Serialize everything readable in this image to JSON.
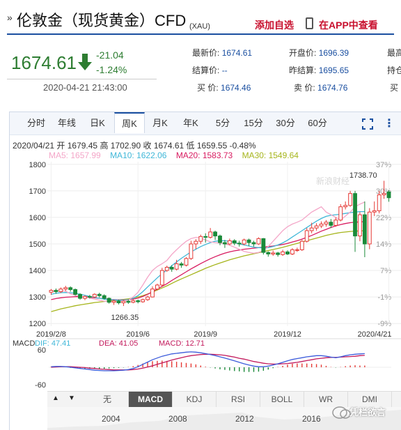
{
  "header": {
    "title_mark": "»",
    "title": "伦敦金（现货黄金）CFD",
    "title_sub": "(XAU)",
    "add_watch": "添加自选",
    "app_view": "在APP中查看"
  },
  "price": {
    "last": "1674.61",
    "change": "-21.04",
    "change_pct": "-1.24%",
    "datetime": "2020-04-21 21:43:00",
    "down_color": "#2e7d32"
  },
  "quotes": [
    {
      "label": "最新价:",
      "value": "1674.61"
    },
    {
      "label": "开盘价:",
      "value": "1696.39"
    },
    {
      "label": "最高",
      "value": ""
    },
    {
      "label": "结算价:",
      "value": "--"
    },
    {
      "label": "昨结算:",
      "value": "1695.65"
    },
    {
      "label": "持仓",
      "value": ""
    },
    {
      "label": "买 价:",
      "value": "1674.46"
    },
    {
      "label": "卖 价:",
      "value": "1674.76"
    },
    {
      "label": "买",
      "value": ""
    }
  ],
  "tabs": [
    "分时",
    "年线",
    "日K",
    "周K",
    "月K",
    "年K",
    "5分",
    "15分",
    "30分",
    "60分"
  ],
  "active_tab": "周K",
  "ohlc": "2020/04/21 开 1679.45 高 1702.90 收 1674.61 低 1659.55 -0.48%",
  "ma": {
    "ma5": "MA5: 1657.99",
    "ma10": "MA10: 1622.06",
    "ma20": "MA20: 1583.73",
    "ma30": "MA30: 1549.64",
    "colors": {
      "ma5": "#f4a6c8",
      "ma10": "#3fb7d8",
      "ma20": "#d81b60",
      "ma30": "#a6b51c"
    }
  },
  "chart_data": {
    "type": "candlestick",
    "y_ticks": [
      "1800",
      "1700",
      "1600",
      "1500",
      "1400",
      "1300",
      "1200"
    ],
    "pct_ticks": [
      "37%",
      "30%",
      "22%",
      "14%",
      "7%",
      "-1%",
      "-9%"
    ],
    "x_ticks": [
      "2019/2/8",
      "2019/6",
      "2019/9",
      "2019/12",
      "2020/4/21"
    ],
    "high_label": "1738.70",
    "low_label": "1266.35",
    "ylim": [
      1190,
      1810
    ],
    "candles": [
      [
        1318,
        1325,
        1308,
        1330
      ],
      [
        1325,
        1320,
        1312,
        1332
      ],
      [
        1320,
        1330,
        1315,
        1336
      ],
      [
        1330,
        1335,
        1322,
        1342
      ],
      [
        1335,
        1328,
        1320,
        1340
      ],
      [
        1328,
        1310,
        1305,
        1332
      ],
      [
        1310,
        1295,
        1290,
        1314
      ],
      [
        1295,
        1302,
        1288,
        1306
      ],
      [
        1302,
        1300,
        1294,
        1308
      ],
      [
        1300,
        1310,
        1296,
        1314
      ],
      [
        1310,
        1305,
        1298,
        1316
      ],
      [
        1305,
        1295,
        1290,
        1310
      ],
      [
        1295,
        1280,
        1275,
        1298
      ],
      [
        1280,
        1285,
        1270,
        1290
      ],
      [
        1285,
        1278,
        1272,
        1290
      ],
      [
        1278,
        1284,
        1266,
        1288
      ],
      [
        1284,
        1280,
        1274,
        1290
      ],
      [
        1280,
        1286,
        1276,
        1292
      ],
      [
        1286,
        1282,
        1276,
        1290
      ],
      [
        1282,
        1290,
        1278,
        1294
      ],
      [
        1290,
        1300,
        1285,
        1305
      ],
      [
        1300,
        1330,
        1298,
        1340
      ],
      [
        1330,
        1345,
        1325,
        1350
      ],
      [
        1345,
        1400,
        1340,
        1410
      ],
      [
        1400,
        1412,
        1395,
        1418
      ],
      [
        1412,
        1405,
        1395,
        1420
      ],
      [
        1405,
        1425,
        1400,
        1440
      ],
      [
        1425,
        1420,
        1410,
        1432
      ],
      [
        1420,
        1445,
        1415,
        1450
      ],
      [
        1445,
        1500,
        1440,
        1512
      ],
      [
        1500,
        1510,
        1480,
        1518
      ],
      [
        1510,
        1528,
        1500,
        1535
      ],
      [
        1528,
        1525,
        1505,
        1540
      ],
      [
        1525,
        1545,
        1520,
        1560
      ],
      [
        1545,
        1530,
        1515,
        1550
      ],
      [
        1530,
        1505,
        1495,
        1535
      ],
      [
        1505,
        1500,
        1485,
        1515
      ],
      [
        1500,
        1512,
        1495,
        1520
      ],
      [
        1512,
        1503,
        1495,
        1518
      ],
      [
        1503,
        1500,
        1490,
        1512
      ],
      [
        1500,
        1515,
        1495,
        1520
      ],
      [
        1515,
        1505,
        1492,
        1520
      ],
      [
        1505,
        1500,
        1490,
        1512
      ],
      [
        1500,
        1520,
        1496,
        1525
      ],
      [
        1520,
        1468,
        1460,
        1522
      ],
      [
        1468,
        1462,
        1452,
        1472
      ],
      [
        1462,
        1466,
        1455,
        1475
      ],
      [
        1466,
        1460,
        1452,
        1470
      ],
      [
        1460,
        1470,
        1455,
        1478
      ],
      [
        1470,
        1462,
        1458,
        1476
      ],
      [
        1462,
        1478,
        1458,
        1484
      ],
      [
        1478,
        1478,
        1470,
        1486
      ],
      [
        1478,
        1510,
        1474,
        1515
      ],
      [
        1510,
        1550,
        1505,
        1560
      ],
      [
        1550,
        1560,
        1540,
        1580
      ],
      [
        1560,
        1568,
        1550,
        1578
      ],
      [
        1568,
        1575,
        1560,
        1585
      ],
      [
        1575,
        1582,
        1565,
        1590
      ],
      [
        1582,
        1570,
        1560,
        1594
      ],
      [
        1570,
        1590,
        1565,
        1600
      ],
      [
        1590,
        1640,
        1585,
        1650
      ],
      [
        1640,
        1645,
        1630,
        1660
      ],
      [
        1645,
        1690,
        1640,
        1700
      ],
      [
        1690,
        1530,
        1470,
        1700
      ],
      [
        1530,
        1610,
        1510,
        1620
      ],
      [
        1610,
        1500,
        1450,
        1660
      ],
      [
        1500,
        1620,
        1480,
        1635
      ],
      [
        1620,
        1625,
        1605,
        1660
      ],
      [
        1625,
        1685,
        1615,
        1700
      ],
      [
        1685,
        1690,
        1670,
        1738
      ],
      [
        1696,
        1674,
        1659,
        1703
      ]
    ],
    "ma_series": {
      "ma5": [
        1318,
        1325,
        1324,
        1322,
        1312,
        1306,
        1302,
        1300,
        1296,
        1292,
        1288,
        1284,
        1283,
        1283,
        1284,
        1286,
        1288,
        1300,
        1318,
        1345,
        1375,
        1400,
        1415,
        1425,
        1438,
        1460,
        1478,
        1495,
        1510,
        1520,
        1525,
        1522,
        1515,
        1508,
        1505,
        1503,
        1500,
        1495,
        1488,
        1480,
        1472,
        1468,
        1465,
        1468,
        1475,
        1490,
        1510,
        1530,
        1550,
        1565,
        1575,
        1582,
        1590,
        1605,
        1620,
        1630,
        1640,
        1620,
        1610,
        1600,
        1590,
        1605,
        1620,
        1640,
        1650,
        1658
      ],
      "ma10": [
        1310,
        1314,
        1316,
        1317,
        1316,
        1314,
        1310,
        1306,
        1302,
        1298,
        1295,
        1292,
        1290,
        1289,
        1288,
        1288,
        1290,
        1295,
        1305,
        1320,
        1338,
        1355,
        1372,
        1388,
        1402,
        1418,
        1432,
        1446,
        1458,
        1470,
        1480,
        1490,
        1498,
        1505,
        1510,
        1512,
        1512,
        1510,
        1505,
        1500,
        1496,
        1492,
        1488,
        1486,
        1485,
        1486,
        1490,
        1496,
        1504,
        1514,
        1526,
        1538,
        1550,
        1562,
        1574,
        1586,
        1596,
        1604,
        1608,
        1610,
        1612,
        1615,
        1618,
        1620,
        1622,
        1622
      ],
      "ma20": [
        1290,
        1294,
        1297,
        1299,
        1300,
        1301,
        1301,
        1300,
        1299,
        1297,
        1295,
        1293,
        1291,
        1290,
        1289,
        1289,
        1290,
        1292,
        1296,
        1302,
        1310,
        1320,
        1330,
        1340,
        1350,
        1362,
        1373,
        1384,
        1395,
        1406,
        1416,
        1426,
        1435,
        1444,
        1452,
        1459,
        1465,
        1470,
        1474,
        1477,
        1480,
        1482,
        1484,
        1486,
        1488,
        1490,
        1492,
        1495,
        1498,
        1502,
        1507,
        1512,
        1518,
        1525,
        1532,
        1540,
        1548,
        1555,
        1562,
        1568,
        1573,
        1577,
        1580,
        1582,
        1583,
        1584
      ],
      "ma30": [
        1245,
        1250,
        1255,
        1259,
        1263,
        1267,
        1270,
        1273,
        1276,
        1279,
        1281,
        1283,
        1285,
        1287,
        1289,
        1291,
        1293,
        1296,
        1300,
        1305,
        1311,
        1318,
        1326,
        1334,
        1342,
        1351,
        1360,
        1368,
        1376,
        1384,
        1392,
        1400,
        1408,
        1415,
        1422,
        1428,
        1434,
        1440,
        1445,
        1450,
        1455,
        1459,
        1463,
        1467,
        1471,
        1475,
        1479,
        1483,
        1487,
        1492,
        1497,
        1502,
        1507,
        1512,
        1517,
        1522,
        1527,
        1532,
        1536,
        1540,
        1543,
        1545,
        1547,
        1548,
        1549,
        1550
      ]
    },
    "macd": {
      "label": "MACD",
      "dif": "DIF: 47.41",
      "dea": "DEA: 41.05",
      "macd": "MACD: 12.71",
      "y_ticks": [
        "60",
        "-60"
      ],
      "ylim": [
        -60,
        60
      ],
      "dif_series": [
        2,
        3,
        3,
        2,
        0,
        -2,
        -4,
        -6,
        -8,
        -10,
        -11,
        -12,
        -12,
        -12,
        -11,
        -10,
        -8,
        -4,
        2,
        10,
        18,
        26,
        32,
        38,
        42,
        46,
        48,
        50,
        52,
        53,
        52,
        50,
        47,
        44,
        40,
        36,
        32,
        27,
        22,
        17,
        12,
        8,
        4,
        2,
        2,
        4,
        8,
        12,
        17,
        22,
        27,
        30,
        33,
        36,
        38,
        40,
        40,
        38,
        35,
        33,
        36,
        40,
        43,
        45,
        46,
        47
      ],
      "dea_series": [
        0,
        1,
        2,
        2,
        2,
        1,
        0,
        -1,
        -3,
        -4,
        -6,
        -7,
        -8,
        -9,
        -9,
        -9,
        -9,
        -8,
        -6,
        -3,
        1,
        5,
        10,
        15,
        20,
        25,
        29,
        33,
        37,
        40,
        42,
        44,
        45,
        45,
        44,
        43,
        41,
        38,
        35,
        31,
        28,
        24,
        20,
        17,
        14,
        12,
        11,
        11,
        12,
        13,
        15,
        17,
        20,
        23,
        26,
        29,
        31,
        33,
        34,
        34,
        35,
        36,
        37,
        38,
        40,
        41
      ],
      "bars": [
        2,
        2,
        1,
        0,
        -2,
        -3,
        -4,
        -5,
        -5,
        -6,
        -5,
        -5,
        -4,
        -3,
        -2,
        -1,
        1,
        4,
        8,
        13,
        17,
        21,
        22,
        23,
        22,
        21,
        19,
        17,
        15,
        13,
        10,
        6,
        2,
        -1,
        -4,
        -7,
        -9,
        -11,
        -13,
        -14,
        -16,
        -16,
        -16,
        -15,
        -12,
        -8,
        -3,
        1,
        5,
        9,
        12,
        13,
        13,
        13,
        12,
        11,
        9,
        5,
        1,
        -1,
        1,
        4,
        6,
        7,
        6,
        6
      ]
    }
  },
  "indicator_tabs": [
    "无",
    "MACD",
    "KDJ",
    "RSI",
    "BOLL",
    "WR",
    "DMI"
  ],
  "active_indicator": "MACD",
  "timeline_years": [
    "2004",
    "2008",
    "2012",
    "2016"
  ],
  "watermark": "新浪财经",
  "badge_text": "凭栏欲言",
  "colors": {
    "up": "#e53935",
    "down": "#1b8a3a",
    "link_red": "#c8102e",
    "accent_blue": "#1a4fa0"
  }
}
